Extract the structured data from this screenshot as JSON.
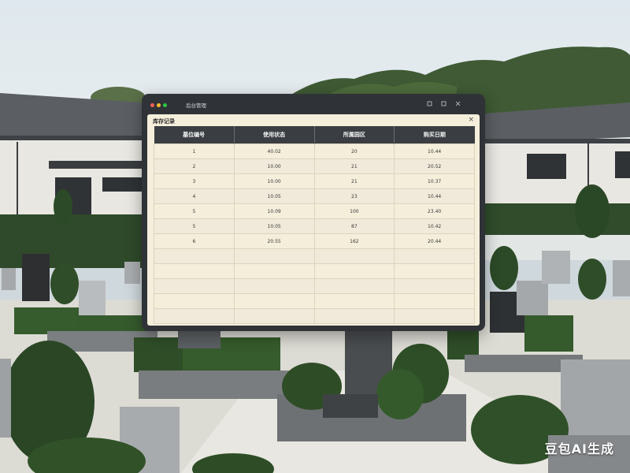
{
  "window": {
    "title": "后台管理",
    "controls": {
      "minimize_icon": "minimize-icon",
      "maximize_icon": "maximize-icon",
      "close_icon": "close-icon"
    }
  },
  "panel": {
    "title": "库存记录",
    "close_label": "×"
  },
  "table": {
    "columns": [
      "墓位编号",
      "使用状态",
      "所属园区",
      "购买日期"
    ],
    "rows": [
      [
        "1",
        "40.02",
        "20",
        "10.44"
      ],
      [
        "2",
        "10.00",
        "21",
        "20.52"
      ],
      [
        "3",
        "10.00",
        "21",
        "10.37"
      ],
      [
        "4",
        "10.05",
        "23",
        "10.44"
      ],
      [
        "5",
        "10.09",
        "100",
        "23.40"
      ],
      [
        "5",
        "10.05",
        "87",
        "10.42"
      ],
      [
        "6",
        "20.55",
        "162",
        "20.44"
      ],
      [
        "",
        "",
        "",
        ""
      ],
      [
        "",
        "",
        "",
        ""
      ],
      [
        "",
        "",
        "",
        ""
      ],
      [
        "",
        "",
        "",
        ""
      ],
      [
        "",
        "",
        "",
        ""
      ]
    ]
  },
  "watermark": "豆包AI生成",
  "colors": {
    "window_bg": "#2f3337",
    "panel_bg": "#f4eedb",
    "header_bg": "#3a3e42",
    "traffic_red": "#ff5f57",
    "traffic_yellow": "#febc2e",
    "traffic_green": "#28c840"
  }
}
